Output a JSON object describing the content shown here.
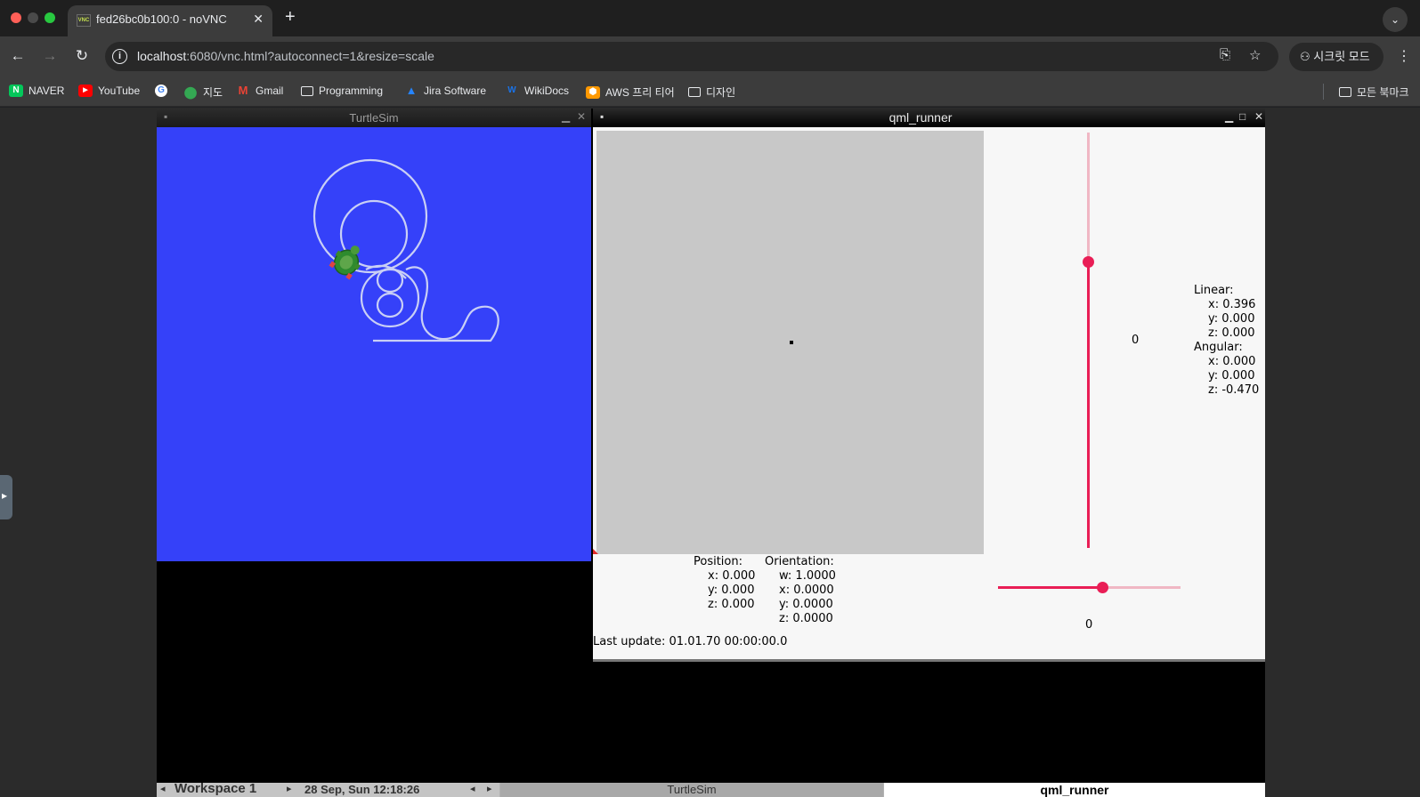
{
  "browser": {
    "tab_title": "fed26bc0b100:0 - noVNC",
    "tab_favicon": "VNC",
    "url_host": "localhost",
    "url_rest": ":6080/vnc.html?autoconnect=1&resize=scale",
    "incognito_label": "시크릿 모드",
    "bookmarks": [
      {
        "label": "NAVER",
        "icon": "naver-icon",
        "color": "#03c75a"
      },
      {
        "label": "YouTube",
        "icon": "youtube-icon",
        "color": "#ff0000"
      },
      {
        "label": "",
        "icon": "google-icon",
        "color": "#ffffff"
      },
      {
        "label": "지도",
        "icon": "maps-icon",
        "color": "#34a853"
      },
      {
        "label": "Gmail",
        "icon": "gmail-icon",
        "color": "#ea4335"
      },
      {
        "label": "Programming",
        "icon": "folder-icon",
        "color": "#e8eaed"
      },
      {
        "label": "Jira Software",
        "icon": "jira-icon",
        "color": "#2684ff"
      },
      {
        "label": "WikiDocs",
        "icon": "wikidocs-icon",
        "color": "#1a73e8"
      },
      {
        "label": "AWS 프리 티어",
        "icon": "aws-icon",
        "color": "#ff9900"
      },
      {
        "label": "디자인",
        "icon": "folder-icon",
        "color": "#e8eaed"
      }
    ],
    "all_bookmarks": "모든 북마크"
  },
  "turtlesim": {
    "title": "TurtleSim",
    "background_color": "#3541f9"
  },
  "qml_runner": {
    "title": "qml_runner",
    "vertical_slider_value": "0",
    "horizontal_slider_value": "0",
    "vertical_slider_fraction": 0.69,
    "horizontal_slider_fraction": 0.58,
    "twist": {
      "linear_label": "Linear:",
      "linear_x": "x: 0.396",
      "linear_y": "y: 0.000",
      "linear_z": "z: 0.000",
      "angular_label": "Angular:",
      "angular_x": "x: 0.000",
      "angular_y": "y: 0.000",
      "angular_z": "z: -0.470"
    },
    "position": {
      "label": "Position:",
      "x": "x: 0.000",
      "y": "y: 0.000",
      "z": "z: 0.000"
    },
    "orientation": {
      "label": "Orientation:",
      "w": "w: 1.0000",
      "x": "x: 0.0000",
      "y": "y: 0.0000",
      "z": "z: 0.0000"
    },
    "last_update": "Last update: 01.01.70 00:00:00.0",
    "accent_color": "#e91e56"
  },
  "taskbar": {
    "workspace": "Workspace 1",
    "datetime": "28 Sep, Sun 12:18:26",
    "task_turtlesim": "TurtleSim",
    "task_qml_runner": "qml_runner"
  }
}
